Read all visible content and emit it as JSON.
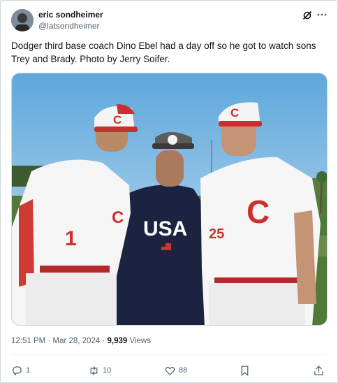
{
  "author": {
    "name": "eric sondheimer",
    "handle": "@latsondheimer"
  },
  "tweet": {
    "text": "Dodger third base coach Dino Ebel had a day off so he got to watch sons Trey and Brady. Photo by Jerry Soifer."
  },
  "photo": {
    "jersey_letter": "C",
    "left_jersey_number": "1",
    "right_jersey_number": "25",
    "cap_letter": "C",
    "shirt_text": "USA"
  },
  "meta": {
    "time": "12:51 PM",
    "separator1": "·",
    "date": "Mar 28, 2024",
    "separator2": "·",
    "views_count": "9,939",
    "views_label": "Views"
  },
  "actions": {
    "replies": "1",
    "reposts": "10",
    "likes": "88"
  },
  "colors": {
    "text": "#0f1419",
    "secondary": "#536471",
    "border": "#cfd9de",
    "jersey_red": "#cf2e2e"
  },
  "icons": [
    "grok-icon",
    "more-icon",
    "reply-icon",
    "repost-icon",
    "like-icon",
    "bookmark-icon",
    "share-icon"
  ]
}
